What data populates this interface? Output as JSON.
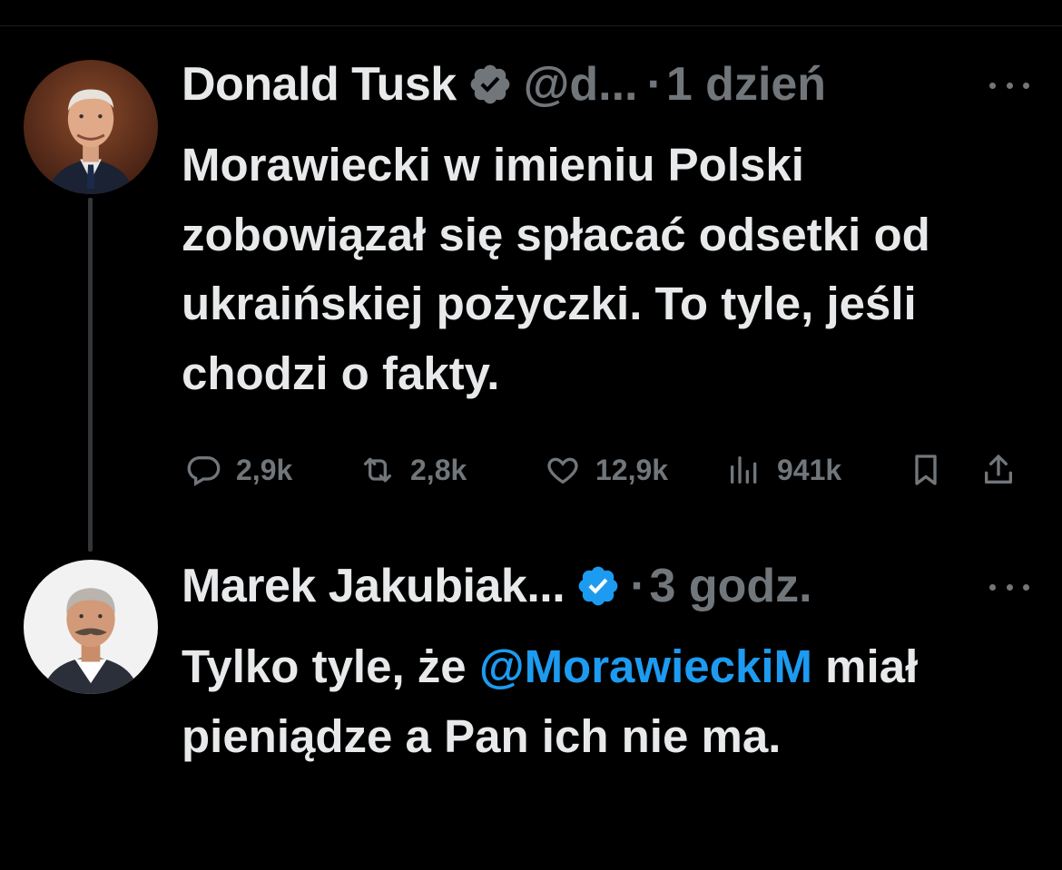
{
  "tweet1": {
    "name": "Donald Tusk",
    "handle": "@d...",
    "dot": "·",
    "time": "1 dzień",
    "text": "Morawiecki w imieniu Polski zobowiązał się spłacać odsetki od ukraińskiej pożyczki. To tyle, jeśli chodzi o fakty.",
    "replies": "2,9k",
    "retweets": "2,8k",
    "likes": "12,9k",
    "views": "941k"
  },
  "tweet2": {
    "name": "Marek Jakubiak...",
    "dot": "·",
    "time": "3 godz.",
    "text_before": "Tylko tyle, że ",
    "mention": "@MorawieckiM",
    "text_after": " miał pieniądze a Pan ich nie ma."
  },
  "colors": {
    "background": "#000000",
    "text": "#e7e9ea",
    "muted": "#71767b",
    "accent": "#1d9bf0"
  },
  "icons": [
    "verified-badge-icon",
    "more-icon",
    "reply-icon",
    "retweet-icon",
    "like-icon",
    "views-icon",
    "bookmark-icon",
    "share-icon"
  ]
}
